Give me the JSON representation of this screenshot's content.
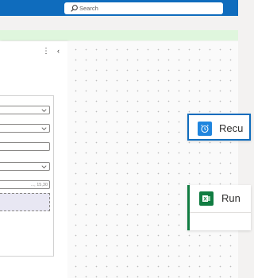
{
  "header": {
    "search": {
      "placeholder": "Search",
      "icon": "search-icon"
    }
  },
  "panel": {
    "more_icon": "⋮",
    "collapse_icon": "‹",
    "fields": [
      {
        "type": "dropdown",
        "value": ""
      },
      {
        "type": "dropdown",
        "value": ""
      },
      {
        "type": "text",
        "value": ""
      },
      {
        "type": "dropdown",
        "value": ""
      },
      {
        "type": "text",
        "placeholder": "..., 15,30"
      }
    ]
  },
  "canvas": {
    "cards": [
      {
        "title": "Recu",
        "icon": "alarm-clock-icon",
        "accent": "#0f6cbd"
      },
      {
        "title": "Run",
        "icon": "excel-icon",
        "accent": "#107c41"
      }
    ]
  },
  "colors": {
    "topbar": "#0f6cbd",
    "banner": "#dff6dd",
    "dashed_fill": "#e8e7f3"
  }
}
